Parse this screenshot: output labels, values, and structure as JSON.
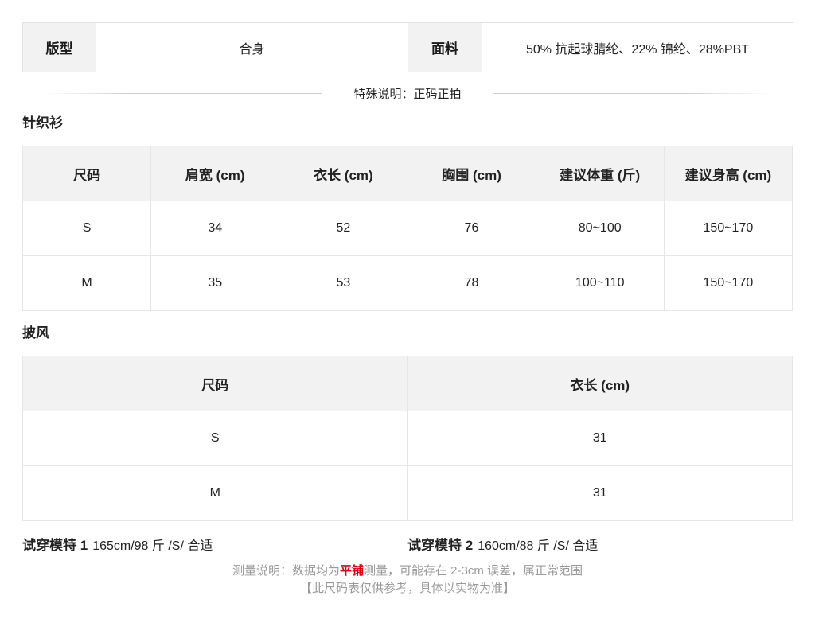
{
  "info": {
    "fit_label": "版型",
    "fit_value": "合身",
    "fabric_label": "面料",
    "fabric_value": "50% 抗起球腈纶、22% 锦纶、28%PBT"
  },
  "special_note": "特殊说明：正码正拍",
  "knit": {
    "title": "针织衫",
    "headers": [
      "尺码",
      "肩宽 (cm)",
      "衣长 (cm)",
      "胸围 (cm)",
      "建议体重 (斤)",
      "建议身高 (cm)"
    ],
    "rows": [
      [
        "S",
        "34",
        "52",
        "76",
        "80~100",
        "150~170"
      ],
      [
        "M",
        "35",
        "53",
        "78",
        "100~110",
        "150~170"
      ]
    ]
  },
  "cape": {
    "title": "披风",
    "headers": [
      "尺码",
      "衣长 (cm)"
    ],
    "rows": [
      [
        "S",
        "31"
      ],
      [
        "M",
        "31"
      ]
    ]
  },
  "models": [
    {
      "label": "试穿模特 1",
      "value": "165cm/98 斤 /S/ 合适"
    },
    {
      "label": "试穿模特 2",
      "value": "160cm/88 斤 /S/ 合适"
    }
  ],
  "footer": {
    "prefix": "测量说明：数据均为",
    "highlight": "平铺",
    "suffix": "测量，可能存在 2-3cm 误差，属正常范围",
    "line2": "【此尺码表仅供参考，具体以实物为准】",
    "highlight_color": "#e60012"
  }
}
